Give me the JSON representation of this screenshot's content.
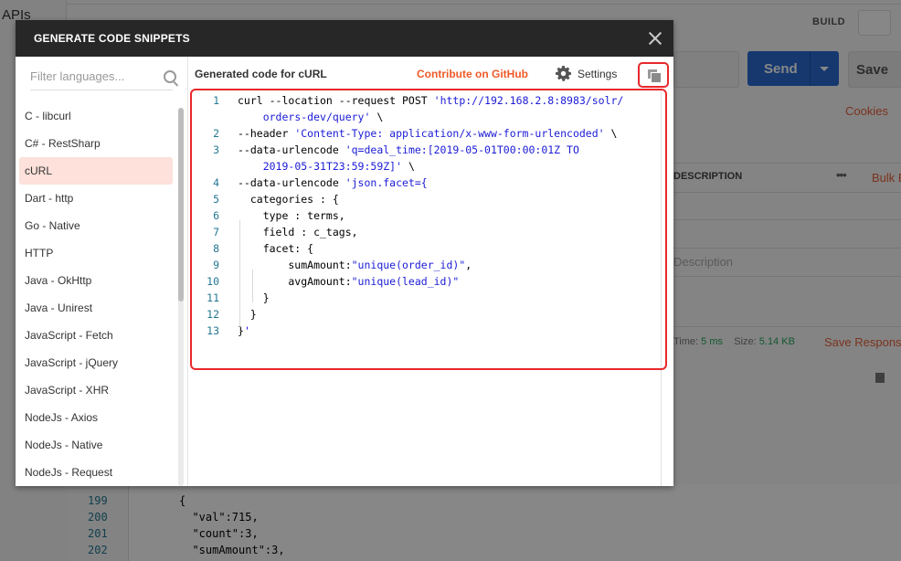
{
  "background_app": {
    "sidebar_label": "APIs",
    "build_label": "BUILD",
    "send_label": "Send",
    "save_label": "Save",
    "cookies_label": "Cookies",
    "description_header": "DESCRIPTION",
    "more_label": "•••",
    "bulk_edit_label": "Bulk Edit",
    "description_placeholder": "Description",
    "time_label": "Time:",
    "time_value": "5 ms",
    "size_label": "Size:",
    "size_value": "5.14 KB",
    "save_response_label": "Save Response",
    "response_lines": [
      {
        "num": "199",
        "code": "{"
      },
      {
        "num": "200",
        "code": "  \"val\":715,"
      },
      {
        "num": "201",
        "code": "  \"count\":3,"
      },
      {
        "num": "202",
        "code": "  \"sumAmount\":3,"
      }
    ]
  },
  "modal": {
    "title": "GENERATE CODE SNIPPETS",
    "filter_placeholder": "Filter languages...",
    "languages": [
      {
        "label": "C - libcurl",
        "active": false
      },
      {
        "label": "C# - RestSharp",
        "active": false
      },
      {
        "label": "cURL",
        "active": true
      },
      {
        "label": "Dart - http",
        "active": false
      },
      {
        "label": "Go - Native",
        "active": false
      },
      {
        "label": "HTTP",
        "active": false
      },
      {
        "label": "Java - OkHttp",
        "active": false
      },
      {
        "label": "Java - Unirest",
        "active": false
      },
      {
        "label": "JavaScript - Fetch",
        "active": false
      },
      {
        "label": "JavaScript - jQuery",
        "active": false
      },
      {
        "label": "JavaScript - XHR",
        "active": false
      },
      {
        "label": "NodeJs - Axios",
        "active": false
      },
      {
        "label": "NodeJs - Native",
        "active": false
      },
      {
        "label": "NodeJs - Request",
        "active": false
      }
    ],
    "code_title": "Generated code for cURL",
    "contribute_label": "Contribute on GitHub",
    "settings_label": "Settings",
    "code_lines": [
      {
        "num": "1",
        "plain": "curl --location --request POST ",
        "str": "'http://192.168.2.8:8983/solr/",
        "tail": ""
      },
      {
        "num": "",
        "plain": "    ",
        "str": "orders-dev/query'",
        "tail": " \\"
      },
      {
        "num": "2",
        "plain": "--header ",
        "str": "'Content-Type: application/x-www-form-urlencoded'",
        "tail": " \\"
      },
      {
        "num": "3",
        "plain": "--data-urlencode ",
        "str": "'q=deal_time:[2019-05-01T00:00:01Z TO",
        "tail": ""
      },
      {
        "num": "",
        "plain": "    ",
        "str": "2019-05-31T23:59:59Z]'",
        "tail": " \\"
      },
      {
        "num": "4",
        "plain": "--data-urlencode ",
        "str": "'json.facet={",
        "tail": ""
      },
      {
        "num": "5",
        "plain": "  categories : {",
        "str": "",
        "tail": ""
      },
      {
        "num": "6",
        "plain": "    type : terms,",
        "str": "",
        "tail": ""
      },
      {
        "num": "7",
        "plain": "    field : c_tags,",
        "str": "",
        "tail": ""
      },
      {
        "num": "8",
        "plain": "    facet: {",
        "str": "",
        "tail": ""
      },
      {
        "num": "9",
        "plain": "        sumAmount:",
        "str": "\"unique(order_id)\"",
        "tail": ","
      },
      {
        "num": "10",
        "plain": "        avgAmount:",
        "str": "\"unique(lead_id)\"",
        "tail": ""
      },
      {
        "num": "11",
        "plain": "    }",
        "str": "",
        "tail": ""
      },
      {
        "num": "12",
        "plain": "  }",
        "str": "",
        "tail": ""
      },
      {
        "num": "13",
        "plain": "}",
        "str": "'",
        "tail": ""
      }
    ]
  },
  "colors": {
    "accent": "#f05a28",
    "highlight_border": "#e8282b",
    "active_language_bg": "#fde1da",
    "send_button": "#2a6bd1",
    "code_string": "#1b1bd6",
    "line_number": "#237893"
  }
}
